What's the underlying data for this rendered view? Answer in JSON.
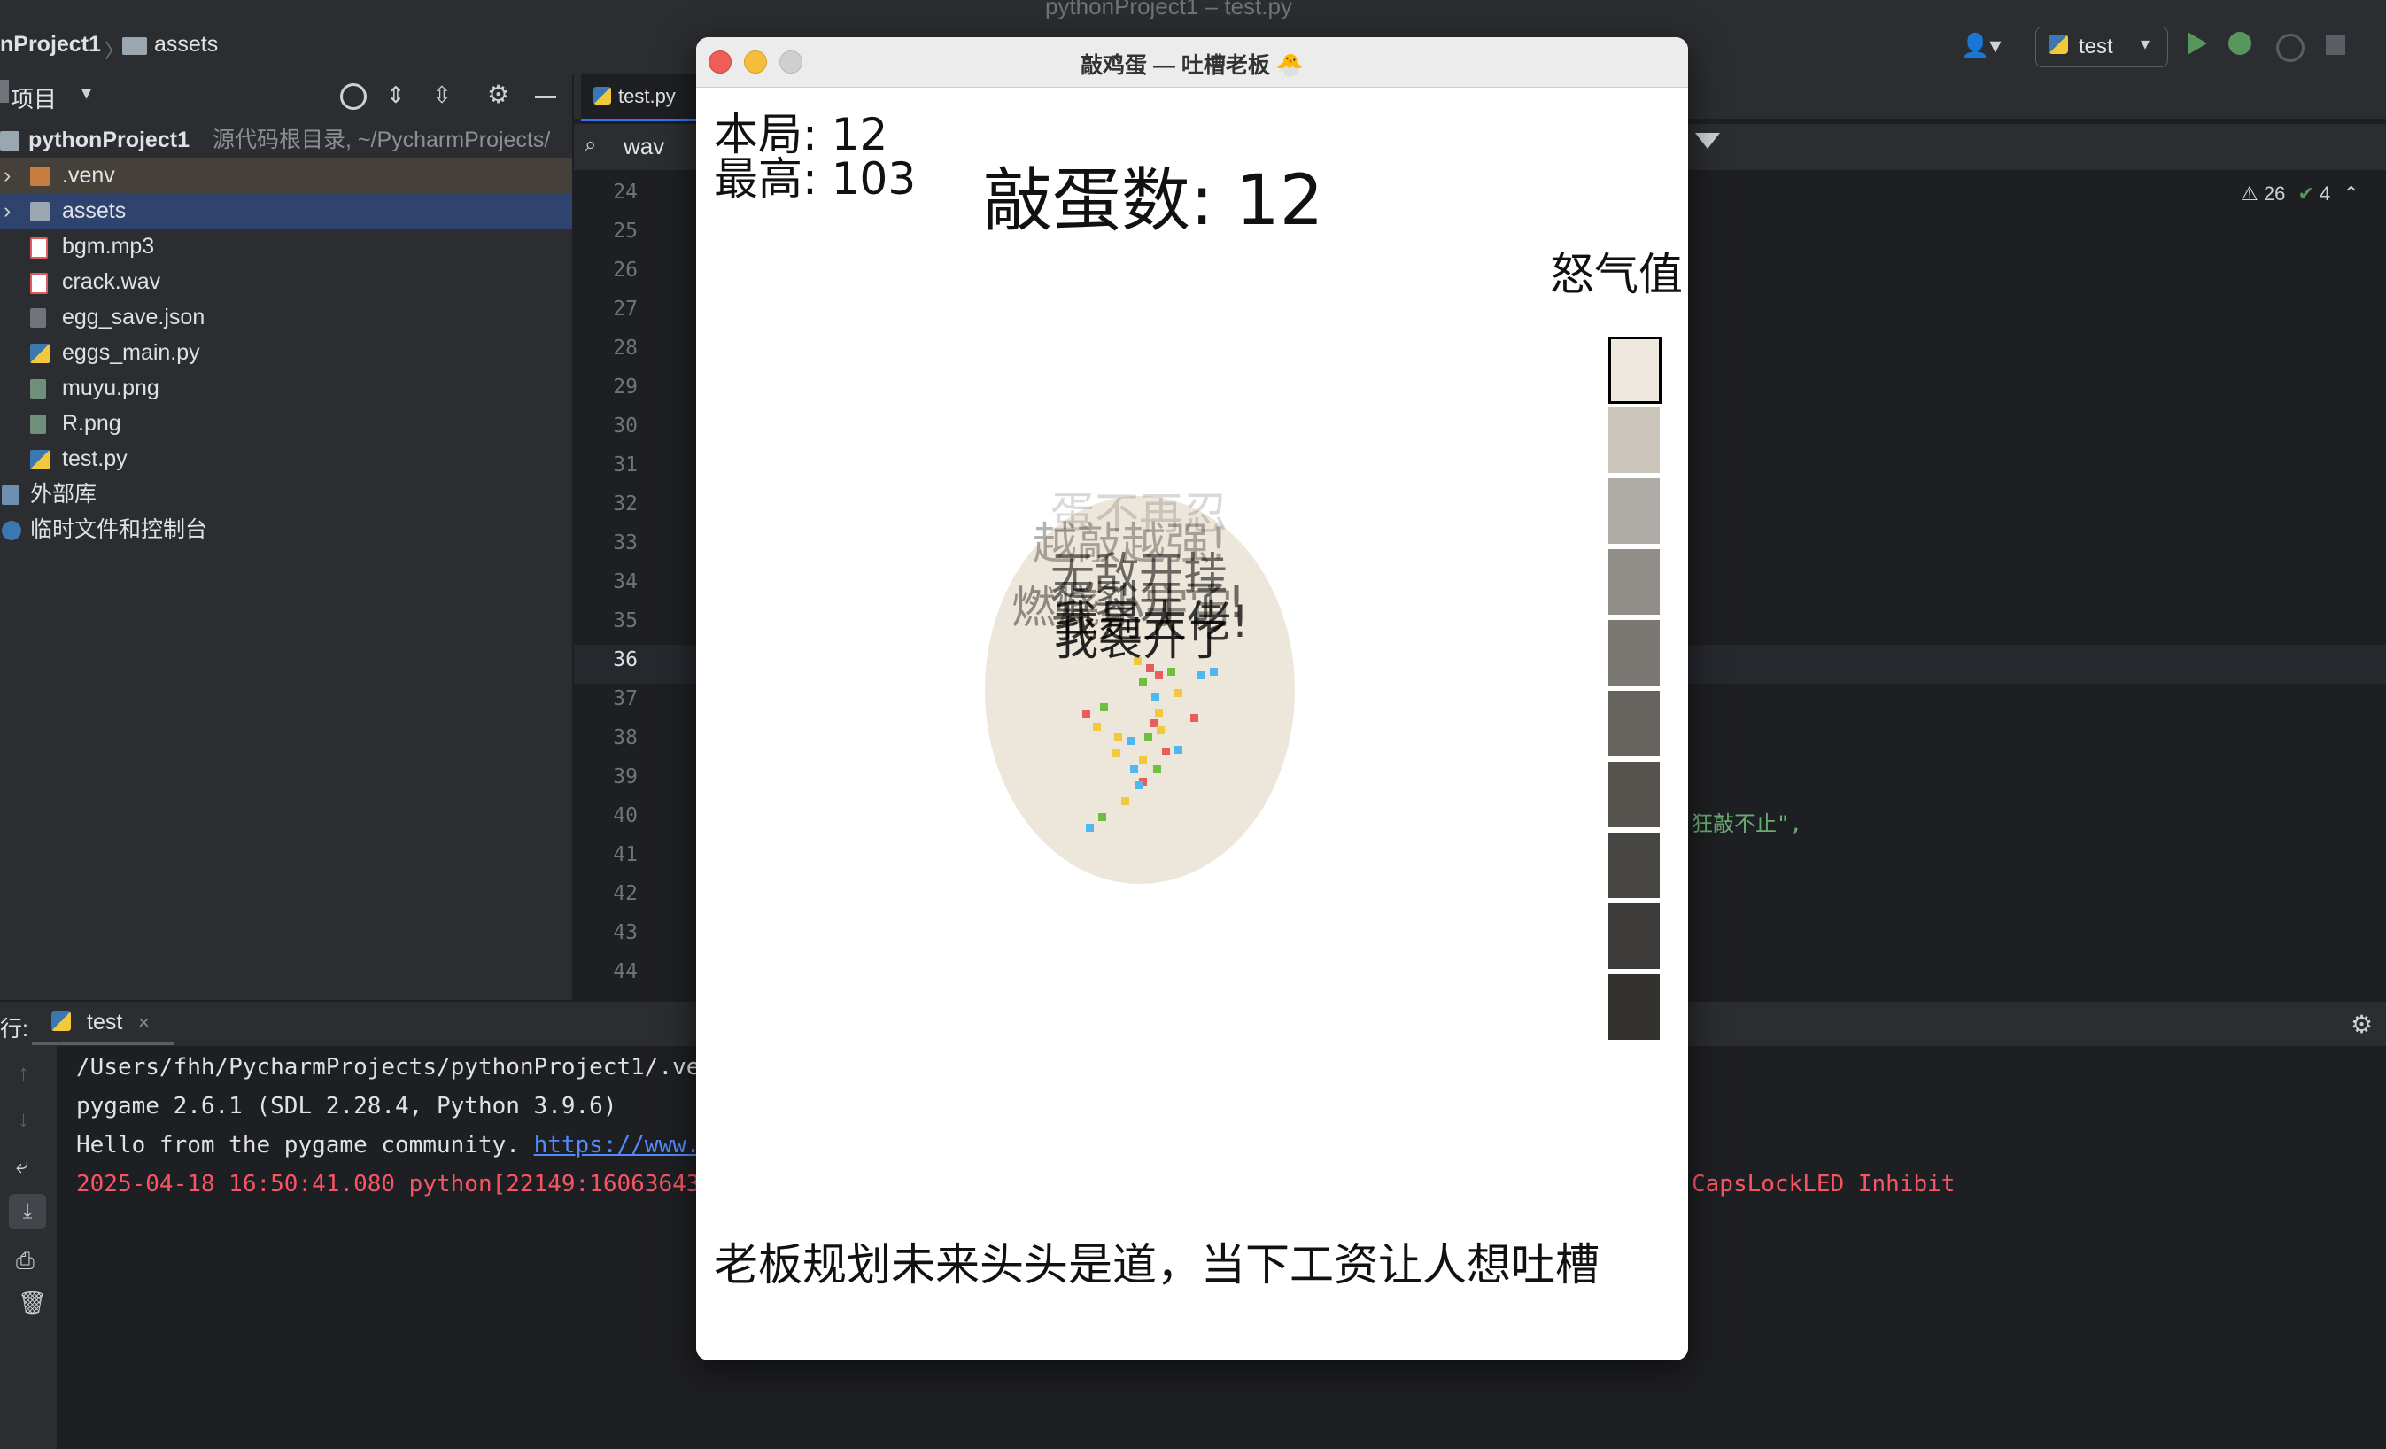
{
  "ide": {
    "window_title": "pythonProject1 – test.py",
    "breadcrumb": [
      "nProject1",
      "assets"
    ],
    "project_label": "项目",
    "run_config": "test",
    "tab_file": "test.py",
    "search_value": "wav",
    "inspection_warnings": "26",
    "inspection_ok": "4",
    "code_snippet": "狂敲不止\",",
    "line_numbers": [
      "24",
      "25",
      "26",
      "27",
      "28",
      "29",
      "30",
      "31",
      "32",
      "33",
      "34",
      "35",
      "36",
      "37",
      "38",
      "39",
      "40",
      "41",
      "42",
      "43",
      "44"
    ],
    "current_line": "36"
  },
  "project_tree": {
    "root": "pythonProject1",
    "root_hint": "源代码根目录, ~/PycharmProjects/",
    "items": [
      {
        "label": ".venv",
        "type": "folder"
      },
      {
        "label": "assets",
        "type": "folder"
      },
      {
        "label": "bgm.mp3",
        "type": "audio"
      },
      {
        "label": "crack.wav",
        "type": "audio"
      },
      {
        "label": "egg_save.json",
        "type": "json"
      },
      {
        "label": "eggs_main.py",
        "type": "python"
      },
      {
        "label": "muyu.png",
        "type": "image"
      },
      {
        "label": "R.png",
        "type": "image"
      },
      {
        "label": "test.py",
        "type": "python"
      }
    ],
    "external_libs": "外部库",
    "scratches": "临时文件和控制台"
  },
  "run_panel": {
    "label": "行:",
    "tab": "test",
    "lines": [
      "/Users/fhh/PycharmProjects/pythonProject1/.ve",
      "pygame 2.6.1 (SDL 2.28.4, Python 3.9.6)",
      "Hello from the pygame community. ",
      "2025-04-18 16:50:41.080 python[22149:16063643"
    ],
    "link_text": "https://www.",
    "error_tail": "CapsLockLED Inhibit"
  },
  "game": {
    "window_title": "敲鸡蛋 — 吐槽老板 🐣",
    "current_round": "本局: 12",
    "best": "最高: 103",
    "hit_count": "敲蛋数: 12",
    "rage_label": "怒气值",
    "rage_level": 1,
    "rage_segments": 10,
    "float_texts": [
      "蛋不再忍",
      "越敲越强!",
      "无敌开挂",
      "蛋裂开了!",
      "燃烧小宇宙",
      "我是大佬!",
      "我裂开了"
    ],
    "complaint": "老板规划未来头头是道，当下工资让人想吐槽",
    "colors": {
      "egg": "#ede6db",
      "rage_scale": [
        "#efe8df",
        "#cbc5bc",
        "#aeaaa5",
        "#918e8a",
        "#7b7874",
        "#676460",
        "#56534f",
        "#484643",
        "#3d3b39",
        "#33322f"
      ]
    }
  }
}
